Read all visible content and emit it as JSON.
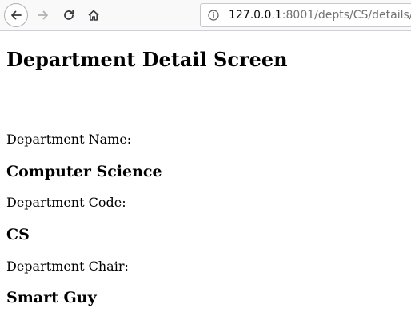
{
  "browser": {
    "url_host": "127.0.0.1",
    "url_rest": ":8001/depts/CS/details/"
  },
  "page": {
    "heading": "Department Detail Screen",
    "fields": [
      {
        "label": "Department Name:",
        "value": "Computer Science"
      },
      {
        "label": "Department Code:",
        "value": "CS"
      },
      {
        "label": "Department Chair:",
        "value": "Smart Guy"
      }
    ]
  }
}
